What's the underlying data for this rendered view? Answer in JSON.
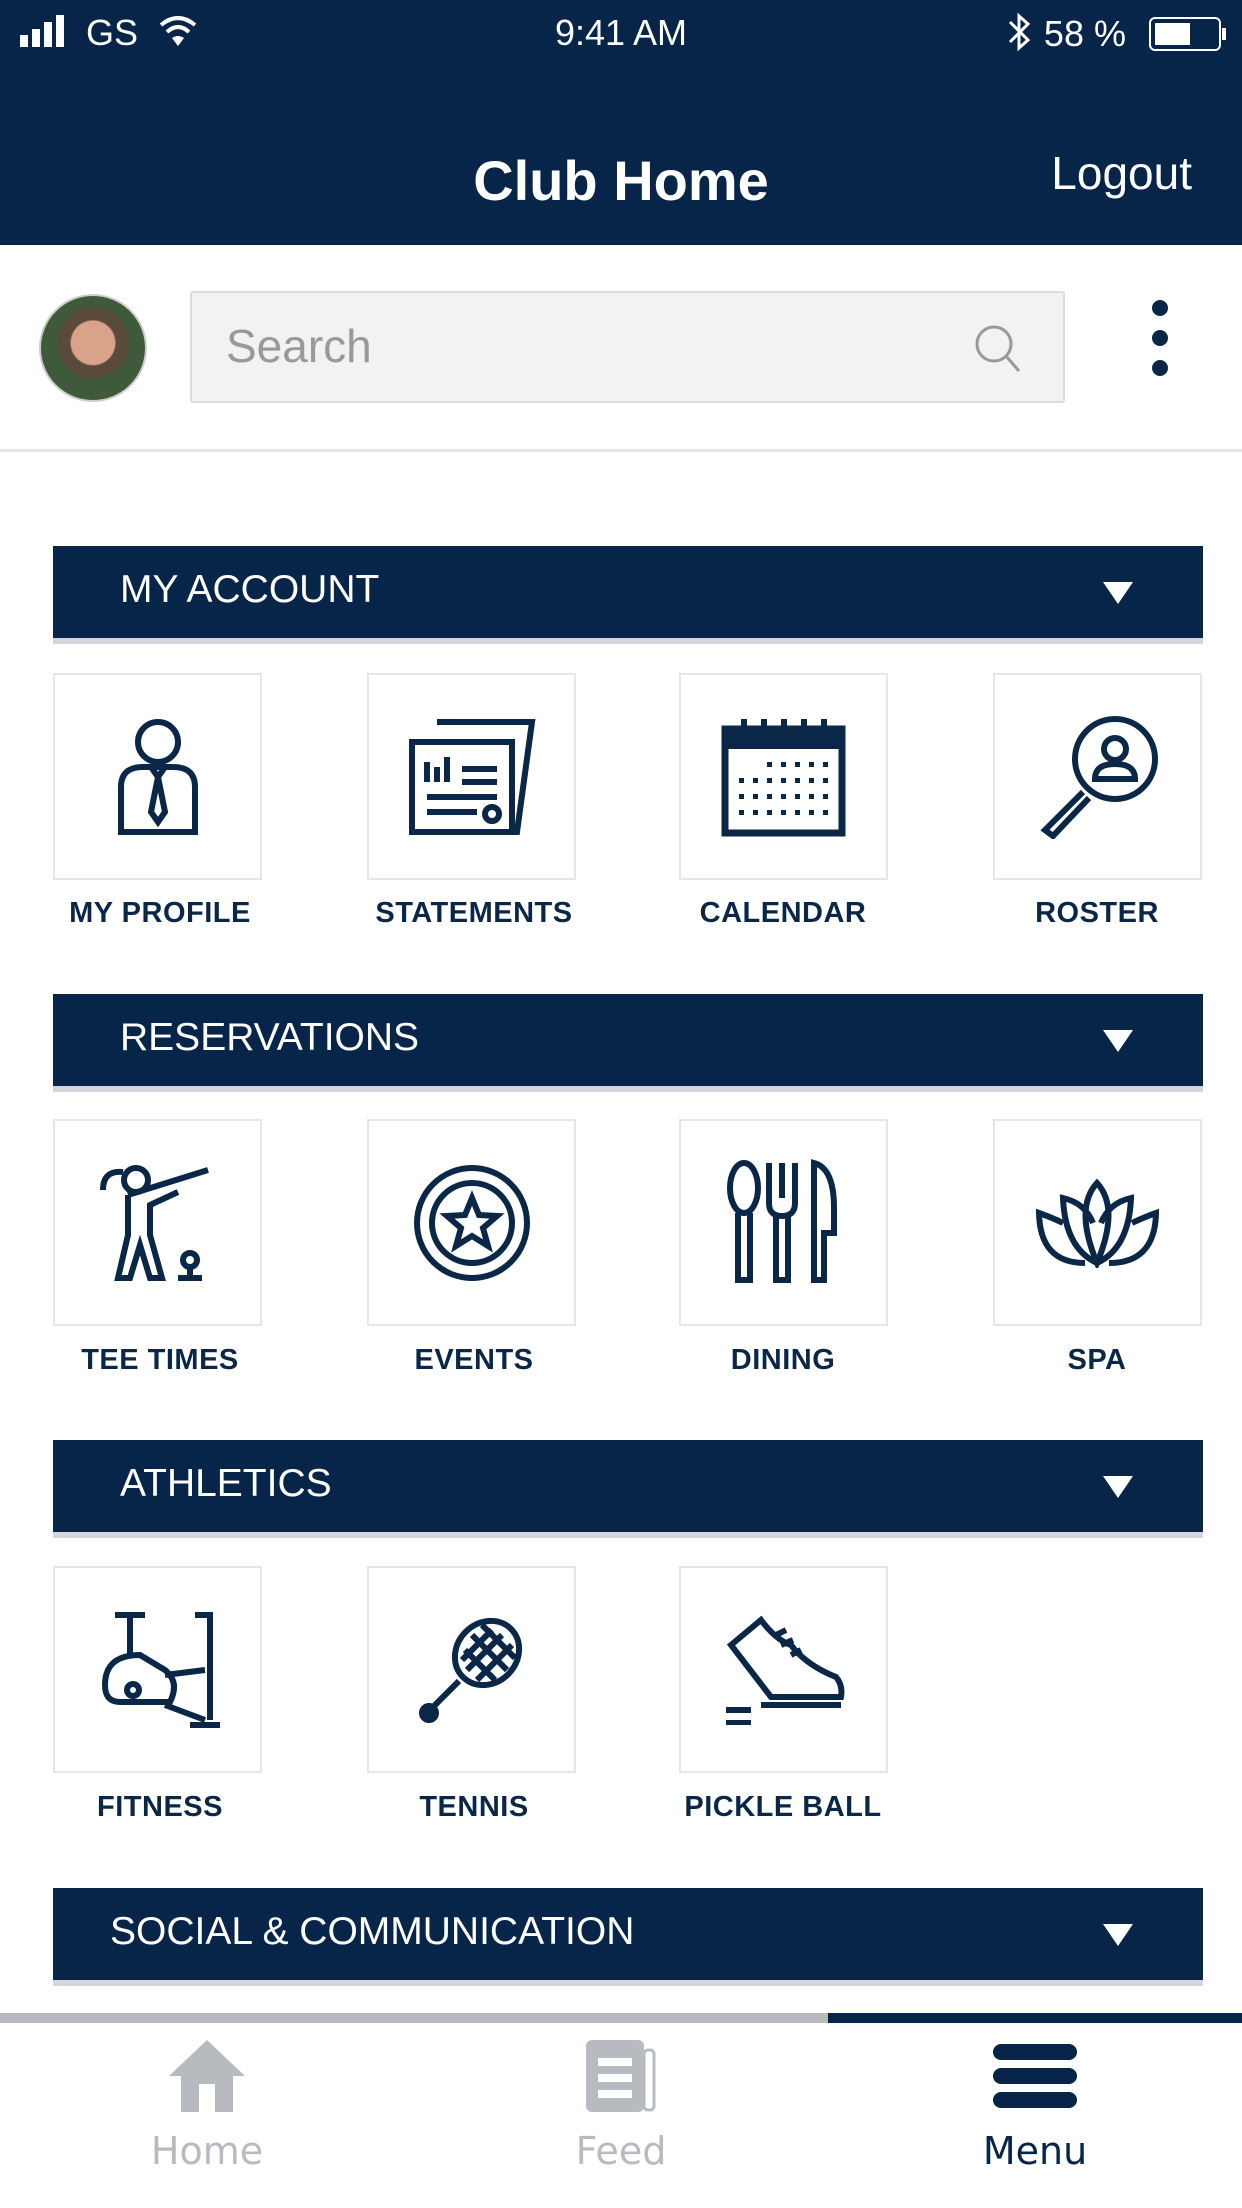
{
  "status_bar": {
    "carrier": "GS",
    "time": "9:41 AM",
    "battery": "58 %",
    "battery_level": 58
  },
  "header": {
    "title": "Club Home",
    "logout": "Logout"
  },
  "search": {
    "placeholder": "Search"
  },
  "colors": {
    "navy": "#062548",
    "inactive": "#b7bbc0"
  },
  "sections": [
    {
      "title": "MY ACCOUNT",
      "items": [
        {
          "label": "MY PROFILE",
          "icon": "profile-icon"
        },
        {
          "label": "STATEMENTS",
          "icon": "statements-icon"
        },
        {
          "label": "CALENDAR",
          "icon": "calendar-icon"
        },
        {
          "label": "ROSTER",
          "icon": "roster-search-icon"
        }
      ]
    },
    {
      "title": "RESERVATIONS",
      "items": [
        {
          "label": "TEE TIMES",
          "icon": "golfer-icon"
        },
        {
          "label": "EVENTS",
          "icon": "star-badge-icon"
        },
        {
          "label": "DINING",
          "icon": "utensils-icon"
        },
        {
          "label": "SPA",
          "icon": "lotus-icon"
        }
      ]
    },
    {
      "title": "ATHLETICS",
      "items": [
        {
          "label": "FITNESS",
          "icon": "exercise-bike-icon"
        },
        {
          "label": "TENNIS",
          "icon": "tennis-racket-icon"
        },
        {
          "label": "PICKLE BALL",
          "icon": "sneaker-icon"
        }
      ]
    },
    {
      "title": "SOCIAL & COMMUNICATION",
      "items": []
    }
  ],
  "tabs": [
    {
      "label": "Home",
      "icon": "home-icon",
      "active": false
    },
    {
      "label": "Feed",
      "icon": "newspaper-icon",
      "active": false
    },
    {
      "label": "Menu",
      "icon": "menu-icon",
      "active": true
    }
  ]
}
